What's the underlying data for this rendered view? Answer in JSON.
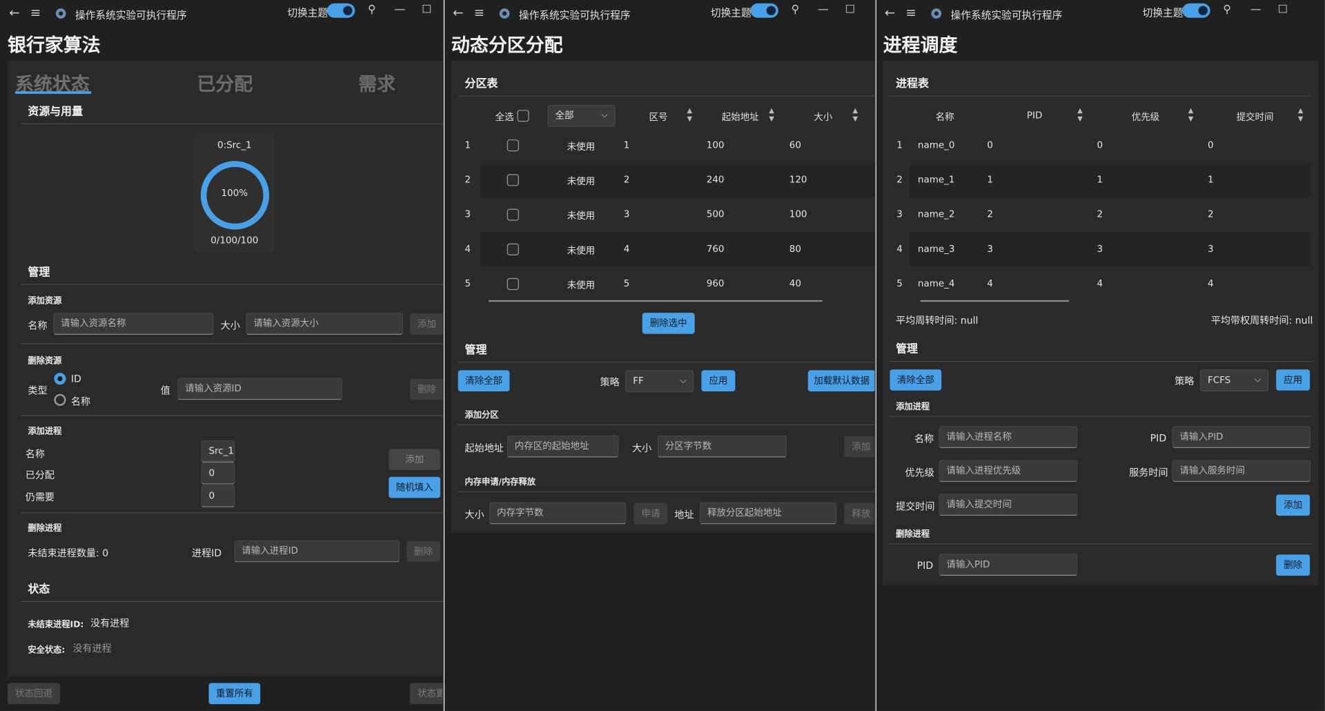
{
  "app": {
    "title": "操作系统实验可执行程序",
    "theme_label": "切换主题",
    "back_glyph": "←",
    "menu_glyph": "≡",
    "pin_glyph": "⚲",
    "min_glyph": "—",
    "max_glyph": "☐"
  },
  "colors": {
    "accent": "#4aa0e6",
    "background": "#202020",
    "card": "#2a2a2a"
  },
  "banker": {
    "page_title": "银行家算法",
    "tabs": [
      "系统状态",
      "已分配",
      "需求"
    ],
    "resources_title": "资源与用量",
    "gauge": {
      "name": "0:Src_1",
      "percent_label": "100%",
      "usage": "0/100/100",
      "fraction": 1.0
    },
    "manage_title": "管理",
    "add_resource": {
      "title": "添加资源",
      "name_label": "名称",
      "name_placeholder": "请输入资源名称",
      "size_label": "大小",
      "size_placeholder": "请输入资源大小",
      "add_button": "添加"
    },
    "delete_resource": {
      "title": "删除资源",
      "type_label": "类型",
      "radio_id": "ID",
      "radio_name": "名称",
      "value_label": "值",
      "value_placeholder": "请输入资源ID",
      "delete_button": "删除"
    },
    "add_process": {
      "title": "添加进程",
      "name_label": "名称",
      "allocated_label": "已分配",
      "need_label": "仍需要",
      "name_value": "Src_1",
      "allocated_value": "0",
      "need_value": "0",
      "add_button": "添加",
      "random_button": "随机填入"
    },
    "delete_process": {
      "title": "删除进程",
      "unfinished_count": "未结束进程数量: 0",
      "pid_label": "进程ID",
      "pid_placeholder": "请输入进程ID",
      "delete_button": "删除"
    },
    "status": {
      "title": "状态",
      "unfinished_label": "未结束进程ID:",
      "unfinished_value": "没有进程",
      "safe_label": "安全状态:",
      "safe_value": "没有进程"
    },
    "footer": {
      "rollback": "状态回退",
      "reset": "重置所有",
      "update": "状态更"
    }
  },
  "partition": {
    "page_title": "动态分区分配",
    "table_title": "分区表",
    "headers": {
      "select_all": "全选",
      "filter": "全部",
      "id": "区号",
      "start": "起始地址",
      "size": "大小"
    },
    "rows": [
      {
        "n": "1",
        "status": "未使用",
        "id": "1",
        "start": "100",
        "size": "60"
      },
      {
        "n": "2",
        "status": "未使用",
        "id": "2",
        "start": "240",
        "size": "120"
      },
      {
        "n": "3",
        "status": "未使用",
        "id": "3",
        "start": "500",
        "size": "100"
      },
      {
        "n": "4",
        "status": "未使用",
        "id": "4",
        "start": "760",
        "size": "80"
      },
      {
        "n": "5",
        "status": "未使用",
        "id": "5",
        "start": "960",
        "size": "40"
      }
    ],
    "delete_selected": "删除选中",
    "manage_title": "管理",
    "clear_all": "清除全部",
    "strategy_label": "策略",
    "strategy_value": "FF",
    "apply": "应用",
    "load_default": "加载默认数据",
    "add_partition": {
      "title": "添加分区",
      "start_label": "起始地址",
      "start_placeholder": "内存区的起始地址",
      "size_label": "大小",
      "size_placeholder": "分区字节数",
      "add_button": "添加"
    },
    "mem": {
      "title": "内存申请/内存释放",
      "size_label": "大小",
      "size_placeholder": "内存字节数",
      "apply_button": "申请",
      "addr_label": "地址",
      "addr_placeholder": "释放分区起始地址",
      "release_button": "释放"
    }
  },
  "sched": {
    "page_title": "进程调度",
    "table_title": "进程表",
    "headers": {
      "name": "名称",
      "pid": "PID",
      "priority": "优先级",
      "submit": "提交时间"
    },
    "rows": [
      {
        "n": "1",
        "name": "name_0",
        "pid": "0",
        "priority": "0",
        "submit": "0"
      },
      {
        "n": "2",
        "name": "name_1",
        "pid": "1",
        "priority": "1",
        "submit": "1"
      },
      {
        "n": "3",
        "name": "name_2",
        "pid": "2",
        "priority": "2",
        "submit": "2"
      },
      {
        "n": "4",
        "name": "name_3",
        "pid": "3",
        "priority": "3",
        "submit": "3"
      },
      {
        "n": "5",
        "name": "name_4",
        "pid": "4",
        "priority": "4",
        "submit": "4"
      }
    ],
    "avg_turnaround": "平均周转时间: null",
    "avg_weighted": "平均带权周转时间: null",
    "manage_title": "管理",
    "clear_all": "清除全部",
    "strategy_label": "策略",
    "strategy_value": "FCFS",
    "apply": "应用",
    "add_process": {
      "title": "添加进程",
      "name_label": "名称",
      "name_placeholder": "请输入进程名称",
      "pid_label": "PID",
      "pid_placeholder": "请输入PID",
      "priority_label": "优先级",
      "priority_placeholder": "请输入进程优先级",
      "service_label": "服务时间",
      "service_placeholder": "请输入服务时间",
      "submit_label": "提交时间",
      "submit_placeholder": "请输入提交时间",
      "add_button": "添加"
    },
    "delete_process": {
      "title": "删除进程",
      "pid_label": "PID",
      "pid_placeholder": "请输入PID",
      "delete_button": "删除"
    }
  }
}
